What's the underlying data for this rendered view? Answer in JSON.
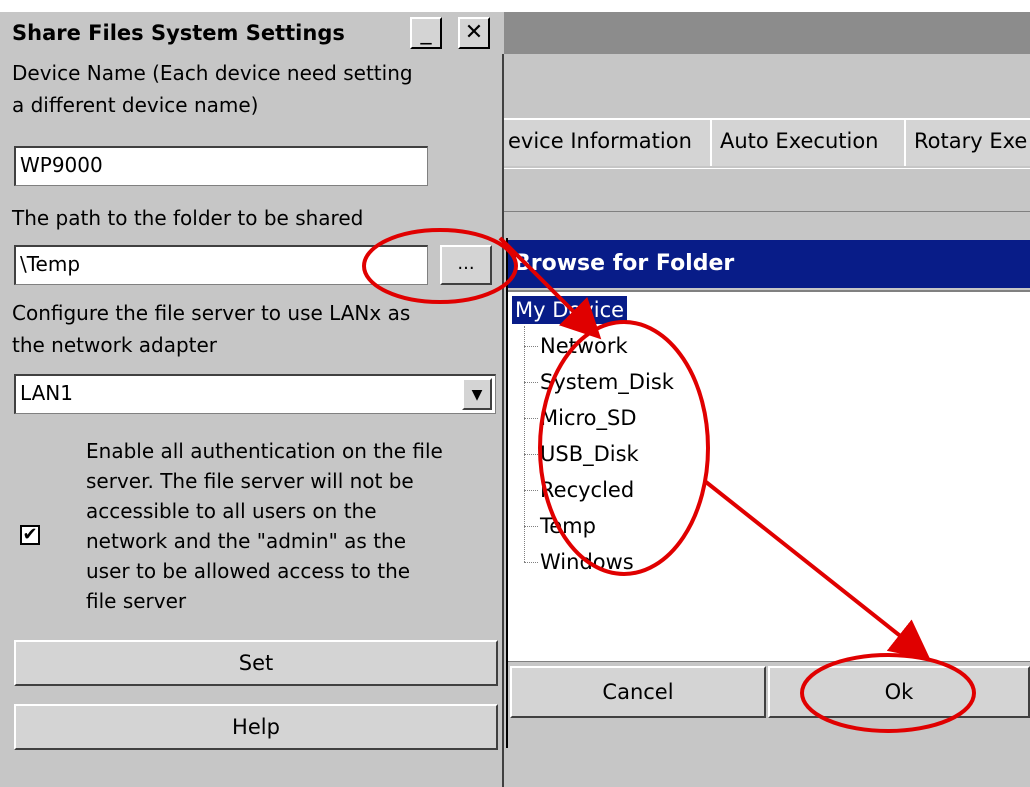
{
  "settings": {
    "title": "Share Files System Settings",
    "minimize_glyph": "_",
    "close_glyph": "✕",
    "device_name_label_line1": "Device Name (Each device need setting",
    "device_name_label_line2": "a different device name)",
    "device_name_value": "WP9000",
    "path_label": "The path to the folder to be shared",
    "path_value": "\\Temp",
    "browse_button_label": "...",
    "lan_label_line1": "Configure the file server to use LANx as",
    "lan_label_line2": "the network adapter",
    "lan_selected": "LAN1",
    "dropdown_glyph": "▼",
    "auth_checked_glyph": "✔",
    "auth_lines": [
      "Enable all authentication on the file",
      "server. The file server will not be",
      "accessible to all users on the",
      "network and the \"admin\" as the",
      "user to be allowed access to the",
      "file server"
    ],
    "set_button": "Set",
    "help_button": "Help"
  },
  "main_window": {
    "tabs": [
      "evice Information",
      "Auto Execution",
      "Rotary Exe"
    ]
  },
  "browse_dialog": {
    "title": "Browse for Folder",
    "root": "My Device",
    "items": [
      "Network",
      "System_Disk",
      "Micro_SD",
      "USB_Disk",
      "Recycled",
      "Temp",
      "Windows"
    ],
    "cancel_button": "Cancel",
    "ok_button": "Ok"
  },
  "colors": {
    "dialog_bg": "#c6c6c6",
    "title_blue": "#081c88",
    "annotation_red": "#e00000"
  }
}
